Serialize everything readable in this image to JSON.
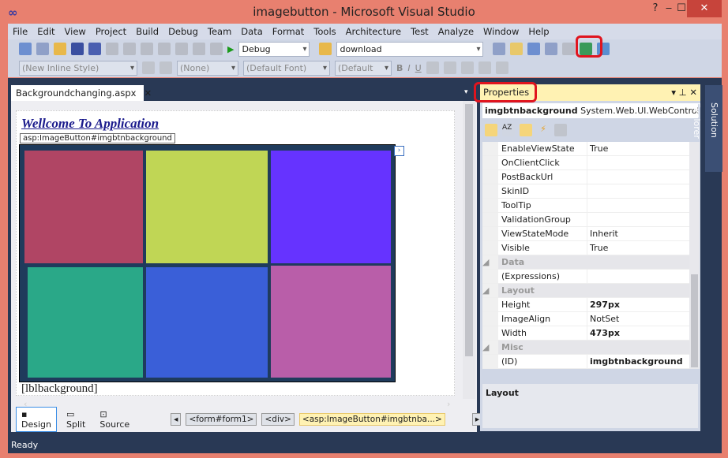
{
  "window": {
    "title": "imagebutton - Microsoft Visual Studio",
    "minimize": "‒",
    "maximize": "☐",
    "close": "✕"
  },
  "menu": [
    "File",
    "Edit",
    "View",
    "Project",
    "Build",
    "Debug",
    "Team",
    "Data",
    "Format",
    "Tools",
    "Architecture",
    "Test",
    "Analyze",
    "Window",
    "Help"
  ],
  "toolbar": {
    "config": "Debug",
    "find": "download",
    "style": "(New Inline Style)",
    "block": "(None)",
    "font": "(Default Font)",
    "size": "(Default",
    "bold": "B",
    "italic": "I",
    "underline": "U"
  },
  "document": {
    "tab": "Backgroundchanging.aspx",
    "heading": "Wellcome To Application",
    "tag": "asp:ImageButton#imgbtnbackground",
    "label": "[lblbackground]",
    "tiles": [
      "#b04564",
      "#c0d655",
      "#6633ff",
      "#2aa888",
      "#3a5fd8",
      "#b95ea9"
    ]
  },
  "views": {
    "design": "Design",
    "split": "Split",
    "source": "Source"
  },
  "breadcrumbs": [
    "<form#form1>",
    "<div>",
    "<asp:ImageButton#imgbtnba...>"
  ],
  "properties": {
    "title": "Properties",
    "object": "imgbtnbackground",
    "type": "System.Web.UI.WebControls.",
    "rows": [
      {
        "name": "EnableViewState",
        "value": "True"
      },
      {
        "name": "OnClientClick",
        "value": ""
      },
      {
        "name": "PostBackUrl",
        "value": ""
      },
      {
        "name": "SkinID",
        "value": ""
      },
      {
        "name": "ToolTip",
        "value": ""
      },
      {
        "name": "ValidationGroup",
        "value": ""
      },
      {
        "name": "ViewStateMode",
        "value": "Inherit"
      },
      {
        "name": "Visible",
        "value": "True"
      },
      {
        "name": "Data",
        "value": "",
        "cat": true
      },
      {
        "name": "(Expressions)",
        "value": ""
      },
      {
        "name": "Layout",
        "value": "",
        "cat": true
      },
      {
        "name": "Height",
        "value": "297px",
        "bold": true
      },
      {
        "name": "ImageAlign",
        "value": "NotSet"
      },
      {
        "name": "Width",
        "value": "473px",
        "bold": true
      },
      {
        "name": "Misc",
        "value": "",
        "cat": true
      },
      {
        "name": "(ID)",
        "value": "imgbtnbackground",
        "bold": true
      }
    ],
    "description": "Layout"
  },
  "solution_explorer": "Solution Explorer",
  "status": "Ready"
}
